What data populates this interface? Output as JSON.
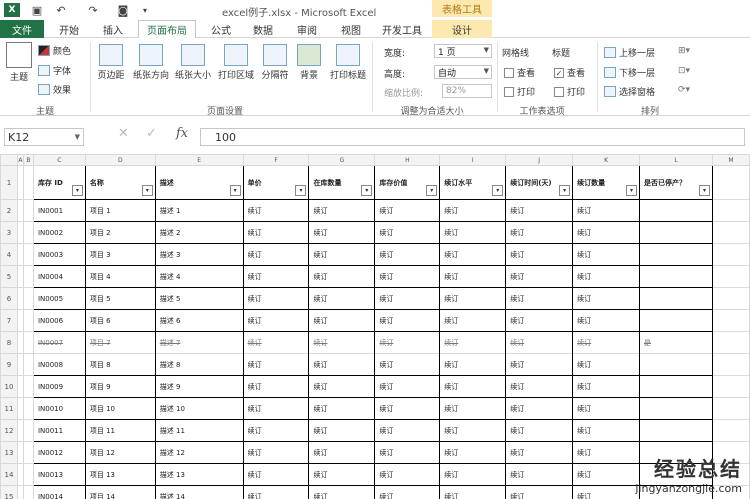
{
  "window": {
    "title": "excel例子.xlsx - Microsoft Excel",
    "table_tools": "表格工具"
  },
  "tabs": [
    {
      "label": "文件"
    },
    {
      "label": "开始"
    },
    {
      "label": "插入"
    },
    {
      "label": "页面布局"
    },
    {
      "label": "公式"
    },
    {
      "label": "数据"
    },
    {
      "label": "审阅"
    },
    {
      "label": "视图"
    },
    {
      "label": "开发工具"
    },
    {
      "label": "设计"
    }
  ],
  "ribbon": {
    "theme": {
      "label": "主题",
      "colors": "颜色",
      "fonts": "字体",
      "effects": "效果",
      "group": "主题"
    },
    "page_setup": {
      "margins": "页边距",
      "orientation": "纸张方向",
      "size": "纸张大小",
      "print_area": "打印区域",
      "breaks": "分隔符",
      "background": "背景",
      "print_titles": "打印标题",
      "group": "页面设置"
    },
    "scale": {
      "width_label": "宽度:",
      "width_value": "1 页",
      "height_label": "高度:",
      "height_value": "自动",
      "scale_label": "缩放比例:",
      "scale_value": "82%",
      "group": "调整为合适大小"
    },
    "sheet_options": {
      "gridlines": "网格线",
      "headings": "标题",
      "view1": "查看",
      "view2": "查看",
      "print1": "打印",
      "print2": "打印",
      "group": "工作表选项"
    },
    "arrange": {
      "bring_forward": "上移一层",
      "send_backward": "下移一层",
      "selection_pane": "选择窗格",
      "group": "排列"
    }
  },
  "formula_bar": {
    "name_box": "K12",
    "fx": "fx",
    "value": "100"
  },
  "grid": {
    "col_letters": [
      "A",
      "B",
      "C",
      "D",
      "E",
      "F",
      "G",
      "H",
      "I",
      "J",
      "K",
      "L",
      "M"
    ],
    "headers": [
      "库存 ID",
      "名称",
      "描述",
      "单价",
      "在库数量",
      "库存价值",
      "续订水平",
      "续订时间(天)",
      "续订数量",
      "是否已停产？"
    ],
    "rows": [
      {
        "n": "2",
        "c": [
          "IN0001",
          "项目 1",
          "描述 1",
          "续订",
          "续订",
          "续订",
          "续订",
          "续订",
          "续订",
          ""
        ]
      },
      {
        "n": "3",
        "c": [
          "IN0002",
          "项目 2",
          "描述 2",
          "续订",
          "续订",
          "续订",
          "续订",
          "续订",
          "续订",
          ""
        ]
      },
      {
        "n": "4",
        "c": [
          "IN0003",
          "项目 3",
          "描述 3",
          "续订",
          "续订",
          "续订",
          "续订",
          "续订",
          "续订",
          ""
        ]
      },
      {
        "n": "5",
        "c": [
          "IN0004",
          "项目 4",
          "描述 4",
          "续订",
          "续订",
          "续订",
          "续订",
          "续订",
          "续订",
          ""
        ]
      },
      {
        "n": "6",
        "c": [
          "IN0005",
          "项目 5",
          "描述 5",
          "续订",
          "续订",
          "续订",
          "续订",
          "续订",
          "续订",
          ""
        ]
      },
      {
        "n": "7",
        "c": [
          "IN0006",
          "项目 6",
          "描述 6",
          "续订",
          "续订",
          "续订",
          "续订",
          "续订",
          "续订",
          ""
        ]
      },
      {
        "n": "8",
        "c": [
          "IN0007",
          "项目 7",
          "描述 7",
          "续订",
          "续订",
          "续订",
          "续订",
          "续订",
          "续订",
          "是"
        ],
        "strike": true
      },
      {
        "n": "9",
        "c": [
          "IN0008",
          "项目 8",
          "描述 8",
          "续订",
          "续订",
          "续订",
          "续订",
          "续订",
          "续订",
          ""
        ]
      },
      {
        "n": "10",
        "c": [
          "IN0009",
          "项目 9",
          "描述 9",
          "续订",
          "续订",
          "续订",
          "续订",
          "续订",
          "续订",
          ""
        ]
      },
      {
        "n": "11",
        "c": [
          "IN0010",
          "项目 10",
          "描述 10",
          "续订",
          "续订",
          "续订",
          "续订",
          "续订",
          "续订",
          ""
        ]
      },
      {
        "n": "12",
        "c": [
          "IN0011",
          "项目 11",
          "描述 11",
          "续订",
          "续订",
          "续订",
          "续订",
          "续订",
          "续订",
          ""
        ]
      },
      {
        "n": "13",
        "c": [
          "IN0012",
          "项目 12",
          "描述 12",
          "续订",
          "续订",
          "续订",
          "续订",
          "续订",
          "续订",
          ""
        ]
      },
      {
        "n": "14",
        "c": [
          "IN0013",
          "项目 13",
          "描述 13",
          "续订",
          "续订",
          "续订",
          "续订",
          "续订",
          "续订",
          ""
        ]
      },
      {
        "n": "15",
        "c": [
          "IN0014",
          "项目 14",
          "描述 14",
          "续订",
          "续订",
          "续订",
          "续订",
          "续订",
          "续订",
          ""
        ]
      }
    ]
  },
  "watermark": {
    "line1": "经验总结",
    "line2": "jingyanzongjie.com"
  },
  "colors": {
    "excel_green": "#217346",
    "table_tools": "#fde9b0"
  }
}
